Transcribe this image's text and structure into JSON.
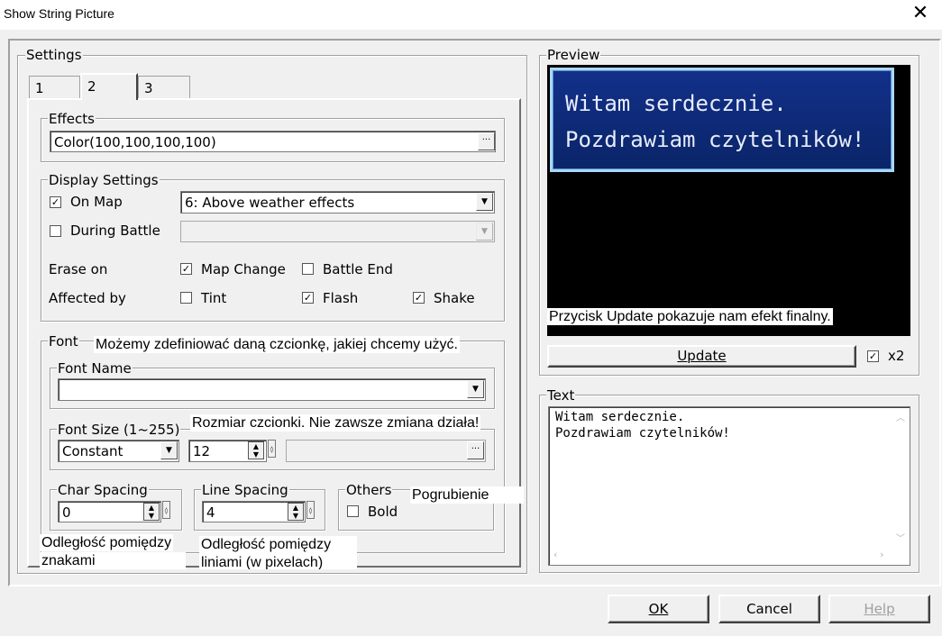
{
  "window": {
    "title": "Show String Picture",
    "close_glyph": "✕"
  },
  "settings": {
    "legend": "Settings",
    "tabs": [
      "1",
      "2",
      "3"
    ],
    "active_tab": "2",
    "effects": {
      "legend": "Effects",
      "value": "Color(100,100,100,100)",
      "ellipsis": "···"
    },
    "display": {
      "legend": "Display Settings",
      "on_map_label": "On Map",
      "on_map_checked": true,
      "on_map_value": "6: Above weather effects",
      "during_battle_label": "During Battle",
      "during_battle_checked": false,
      "during_battle_value": "",
      "erase_on_label": "Erase on",
      "map_change_label": "Map Change",
      "map_change_checked": true,
      "battle_end_label": "Battle End",
      "battle_end_checked": false,
      "affected_by_label": "Affected by",
      "tint_label": "Tint",
      "tint_checked": false,
      "flash_label": "Flash",
      "flash_checked": true,
      "shake_label": "Shake",
      "shake_checked": true
    },
    "font": {
      "legend": "Font",
      "font_name_legend": "Font Name",
      "font_name_value": "",
      "font_size_legend": "Font Size (1~255)",
      "font_size_mode": "Constant",
      "font_size_value": "12",
      "font_size_var": "",
      "char_spacing_legend": "Char Spacing",
      "char_spacing_value": "0",
      "line_spacing_legend": "Line Spacing",
      "line_spacing_value": "4",
      "others_legend": "Others",
      "bold_label": "Bold",
      "bold_checked": false
    }
  },
  "preview": {
    "legend": "Preview",
    "lines": [
      "Witam serdecznie.",
      "Pozdrawiam czytelników!"
    ],
    "update_label": "Update",
    "x2_label": "x2",
    "x2_checked": true
  },
  "text": {
    "legend": "Text",
    "lines": [
      "Witam serdecznie.",
      "Pozdrawiam czytelników!"
    ]
  },
  "buttons": {
    "ok": "OK",
    "cancel": "Cancel",
    "help": "Help"
  },
  "annotations": {
    "font": "Możemy zdefiniować daną czcionkę, jakiej chcemy użyć.",
    "font_size": "Rozmiar czcionki. Nie zawsze zmiana działa!",
    "bold": "Pogrubienie",
    "char_spacing_1": "Odległość pomiędzy",
    "char_spacing_2": "znakami",
    "line_spacing_1": "Odległość pomiędzy",
    "line_spacing_2": "liniami (w pixelach)",
    "update": "Przycisk Update pokazuje nam efekt finalny."
  },
  "colors": {
    "preview_window_bg": "#0d2a78",
    "preview_window_border": "#a8d8f8",
    "preview_text": "#e8ecf8",
    "preview_bg": "#000000"
  }
}
